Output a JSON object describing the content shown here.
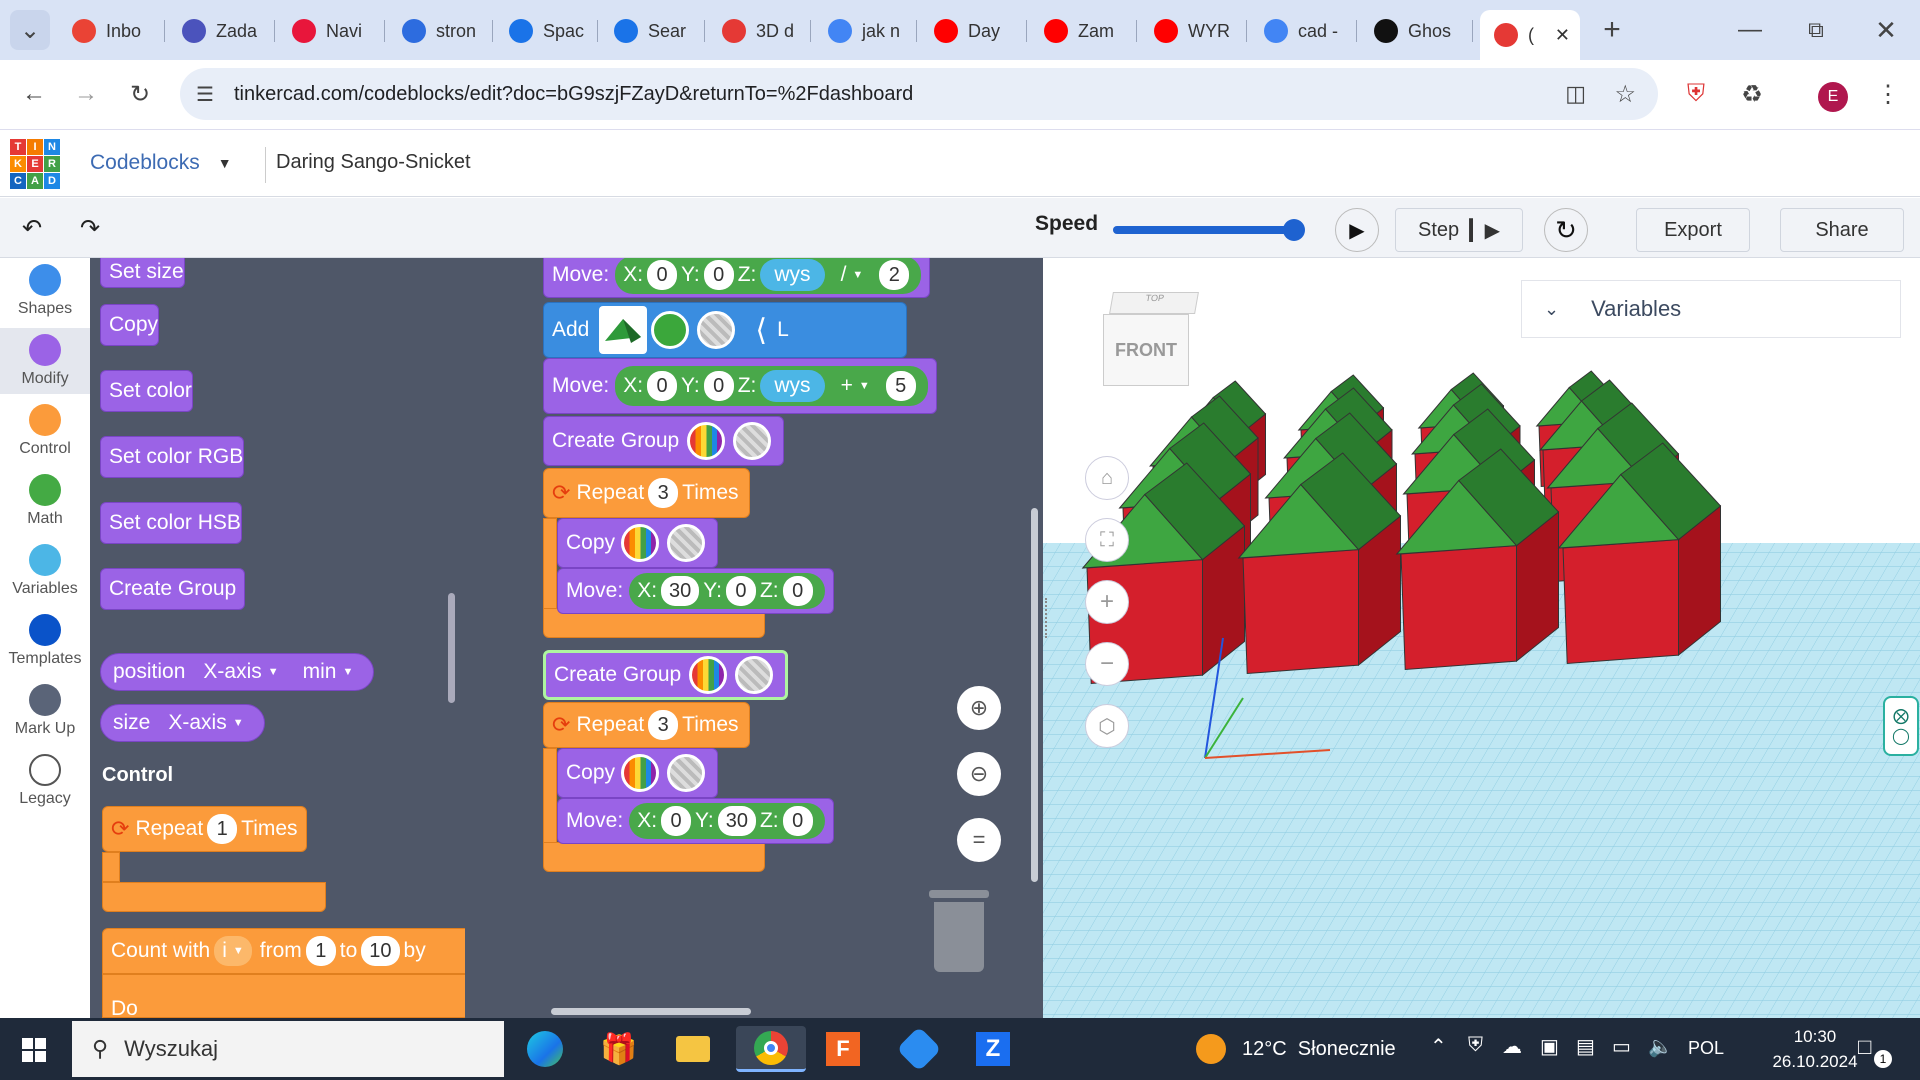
{
  "browser": {
    "tabs": [
      {
        "label": "Inbo",
        "icon": "gmail-icon",
        "color": "#ea4335"
      },
      {
        "label": "Zada",
        "icon": "teams-icon",
        "color": "#4b53bc"
      },
      {
        "label": "Navi",
        "icon": "youtube-icon",
        "color": "#e8163b"
      },
      {
        "label": "stron",
        "icon": "classroom-icon",
        "color": "#2d6cdf"
      },
      {
        "label": "Spac",
        "icon": "space-icon",
        "color": "#1a73e8"
      },
      {
        "label": "Sear",
        "icon": "search-app-icon",
        "color": "#1a73e8"
      },
      {
        "label": "3D d",
        "icon": "tinkercad-icon",
        "color": "#e53935"
      },
      {
        "label": "jak n",
        "icon": "google-icon",
        "color": "#4285f4"
      },
      {
        "label": "Day",
        "icon": "youtube-icon",
        "color": "#ff0000"
      },
      {
        "label": "Zam",
        "icon": "youtube-icon",
        "color": "#ff0000"
      },
      {
        "label": "WYR",
        "icon": "youtube-icon",
        "color": "#ff0000"
      },
      {
        "label": "cad -",
        "icon": "google-icon",
        "color": "#4285f4"
      },
      {
        "label": "Ghos",
        "icon": "openai-icon",
        "color": "#111111"
      },
      {
        "label": "(",
        "icon": "tinkercad-icon",
        "color": "#e53935"
      }
    ],
    "url": "tinkercad.com/codeblocks/edit?doc=bG9szjFZayD&returnTo=%2Fdashboard",
    "profile_initial": "E"
  },
  "app": {
    "logo_letters": [
      "T",
      "I",
      "N",
      "K",
      "E",
      "R",
      "C",
      "A",
      "D"
    ],
    "mode_label": "Codeblocks",
    "design_name": "Daring Sango-Snicket",
    "speed_label": "Speed",
    "speed_value": 0.95,
    "step_label": "Step",
    "export_label": "Export",
    "share_label": "Share"
  },
  "categories": [
    {
      "label": "Shapes",
      "color": "#3d8eea"
    },
    {
      "label": "Modify",
      "color": "#9b63e6"
    },
    {
      "label": "Control",
      "color": "#fb9b3b"
    },
    {
      "label": "Math",
      "color": "#44aa44"
    },
    {
      "label": "Variables",
      "color": "#4cb6e6"
    },
    {
      "label": "Templates",
      "color": "#0a53c9"
    },
    {
      "label": "Mark Up",
      "color": "#5a6478"
    },
    {
      "label": "Legacy",
      "color": "#ffffff"
    }
  ],
  "palette": {
    "set_size": "Set size",
    "copy": "Copy",
    "set_color": "Set color",
    "set_color_rgb": "Set color RGB",
    "set_color_hsb": "Set color HSB",
    "create_group": "Create Group",
    "position_label": "position",
    "position_axis": "X-axis",
    "position_mode": "min",
    "size_label": "size",
    "size_axis": "X-axis",
    "control_heading": "Control",
    "repeat_label": "Repeat",
    "repeat_count": "1",
    "times_label": "Times",
    "count_with": "Count with",
    "count_var": "i",
    "from_label": "from",
    "from_value": "1",
    "to_label": "to",
    "to_value": "10",
    "by_label": "by",
    "do_label": "Do"
  },
  "workspace": {
    "move1": {
      "label": "Move:",
      "x": "0",
      "y": "0",
      "z_var": "wys",
      "op": "/",
      "num": "2"
    },
    "add": {
      "label": "Add",
      "var": "L"
    },
    "move2": {
      "label": "Move:",
      "x": "0",
      "y": "0",
      "z_var": "wys",
      "op": "+",
      "num": "5"
    },
    "group1": "Create Group",
    "repeat1": {
      "label": "Repeat",
      "count": "3",
      "times": "Times"
    },
    "copy1": "Copy",
    "move3": {
      "label": "Move:",
      "x": "30",
      "y": "0",
      "z": "0"
    },
    "group2": "Create Group",
    "repeat2": {
      "label": "Repeat",
      "count": "3",
      "times": "Times"
    },
    "copy2": "Copy",
    "move4": {
      "label": "Move:",
      "x": "0",
      "y": "30",
      "z": "0"
    },
    "axis_labels": {
      "x": "X:",
      "y": "Y:",
      "z": "Z:"
    }
  },
  "viewport": {
    "viewcube_top": "TOP",
    "viewcube_front": "FRONT",
    "variables_label": "Variables"
  },
  "taskbar": {
    "search_placeholder": "Wyszukaj",
    "weather": "12°C  Słonecznie",
    "lang": "POL",
    "time": "10:30",
    "date": "26.10.2024",
    "notif_count": "1"
  }
}
